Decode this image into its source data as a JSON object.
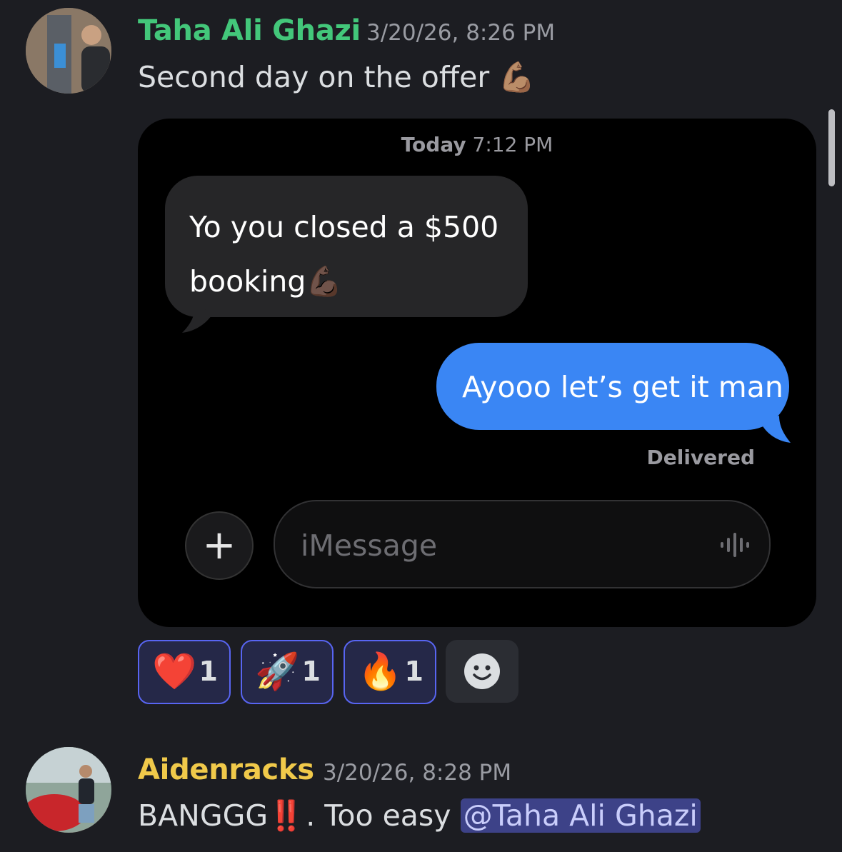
{
  "messages": [
    {
      "author": "Taha Ali Ghazi",
      "author_color": "#43c77a",
      "timestamp": "3/20/26, 8:26 PM",
      "text": "Second day on the offer",
      "text_emoji": "💪🏽",
      "attachment": {
        "header_day": "Today",
        "header_time": "7:12 PM",
        "incoming_text": "Yo you closed a $500 booking",
        "incoming_emoji": "💪🏿",
        "outgoing_text": "Ayooo let’s get it man",
        "status": "Delivered",
        "input_placeholder": "iMessage",
        "plus_label": "+"
      },
      "reactions": [
        {
          "emoji": "❤️",
          "count": "1",
          "icon": "heart-icon"
        },
        {
          "emoji": "🚀",
          "count": "1",
          "icon": "rocket-icon"
        },
        {
          "emoji": "🔥",
          "count": "1",
          "icon": "fire-icon"
        }
      ]
    },
    {
      "author": "Aidenracks",
      "author_color": "#f0c94a",
      "timestamp": "3/20/26, 8:28 PM",
      "text_before": "BANGGG",
      "bangs": "‼️",
      "text_after": ". Too easy ",
      "mention": "@Taha Ali Ghazi"
    }
  ],
  "colors": {
    "background": "#1c1d22",
    "imessage_blue": "#3a86f4",
    "mention_bg": "#3d4288",
    "reaction_border": "#5865f2"
  }
}
